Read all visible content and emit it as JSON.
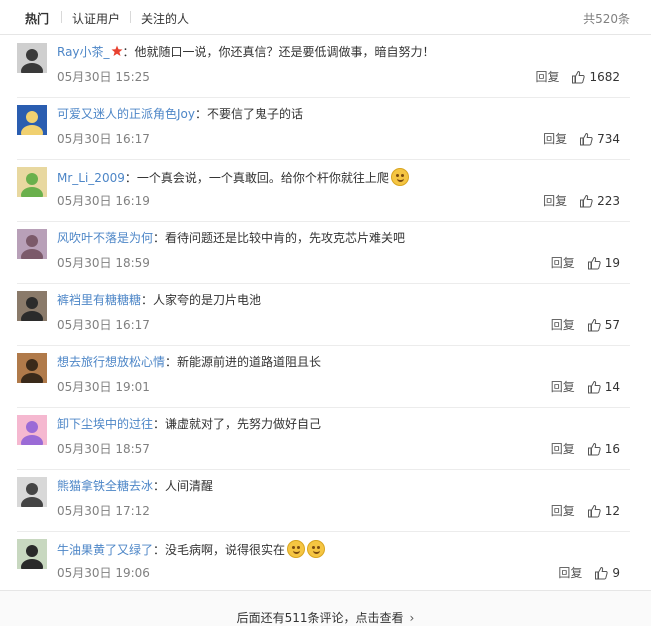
{
  "tabs": {
    "hot": "热门",
    "verified": "认证用户",
    "following": "关注的人",
    "total": "共520条"
  },
  "comments": [
    {
      "user": "Ray小茶_",
      "text": "他就随口一说，你还真信？还是要低调做事，暗自努力！",
      "time": "05月30日 15:25",
      "reply": "回复",
      "likes": "1682",
      "vip": true,
      "emoji": 0
    },
    {
      "user": "可爱又迷人的正派角色Joy",
      "text": "不要信了鬼子的话",
      "time": "05月30日 16:17",
      "reply": "回复",
      "likes": "734",
      "vip": false,
      "emoji": 0
    },
    {
      "user": "Mr_Li_2009",
      "text": "一个真会说，一个真敢回。给你个杆你就往上爬",
      "time": "05月30日 16:19",
      "reply": "回复",
      "likes": "223",
      "vip": false,
      "emoji": 1
    },
    {
      "user": "风吹叶不落是为何",
      "text": "看待问题还是比较中肯的，先攻克芯片难关吧",
      "time": "05月30日 18:59",
      "reply": "回复",
      "likes": "19",
      "vip": false,
      "emoji": 0
    },
    {
      "user": "裤裆里有糖糖糖",
      "text": "人家夸的是刀片电池",
      "time": "05月30日 16:17",
      "reply": "回复",
      "likes": "57",
      "vip": false,
      "emoji": 0
    },
    {
      "user": "想去旅行想放松心情",
      "text": "新能源前进的道路道阻且长",
      "time": "05月30日 19:01",
      "reply": "回复",
      "likes": "14",
      "vip": false,
      "emoji": 0
    },
    {
      "user": "卸下尘埃中的过往",
      "text": "谦虚就对了，先努力做好自己",
      "time": "05月30日 18:57",
      "reply": "回复",
      "likes": "16",
      "vip": false,
      "emoji": 0
    },
    {
      "user": "熊猫拿铁全糖去冰",
      "text": "人间清醒",
      "time": "05月30日 17:12",
      "reply": "回复",
      "likes": "12",
      "vip": false,
      "emoji": 0
    },
    {
      "user": "牛油果黄了又绿了",
      "text": "没毛病啊，说得很实在",
      "time": "05月30日 19:06",
      "reply": "回复",
      "likes": "9",
      "vip": false,
      "emoji": 2
    }
  ],
  "footer": {
    "more": "后面还有511条评论，点击查看"
  }
}
